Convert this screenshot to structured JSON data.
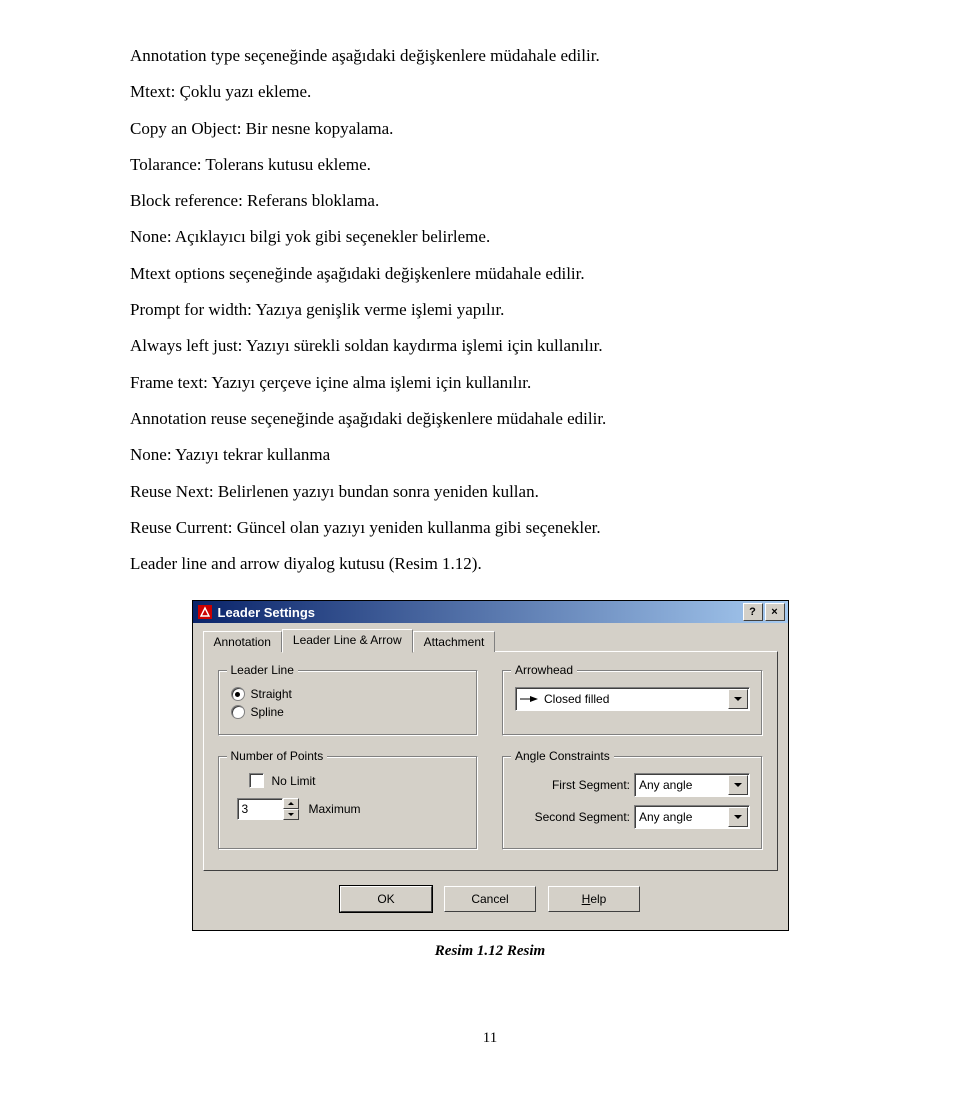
{
  "paragraphs": [
    "Annotation type seçeneğinde aşağıdaki değişkenlere müdahale edilir.",
    "Mtext: Çoklu yazı ekleme.",
    "Copy an Object: Bir nesne kopyalama.",
    "Tolarance: Tolerans kutusu ekleme.",
    "Block reference: Referans bloklama.",
    "None: Açıklayıcı bilgi yok gibi seçenekler belirleme.",
    "Mtext options seçeneğinde aşağıdaki değişkenlere müdahale edilir.",
    "Prompt for width: Yazıya genişlik verme işlemi yapılır.",
    "Always left just: Yazıyı sürekli soldan kaydırma işlemi için kullanılır.",
    "Frame text: Yazıyı çerçeve içine alma işlemi için kullanılır.",
    "Annotation reuse seçeneğinde aşağıdaki değişkenlere müdahale edilir.",
    "None: Yazıyı tekrar kullanma",
    "Reuse Next: Belirlenen yazıyı bundan sonra yeniden kullan.",
    "Reuse Current: Güncel olan yazıyı yeniden kullanma gibi seçenekler.",
    "Leader line and arrow diyalog kutusu (Resim 1.12)."
  ],
  "dialog": {
    "title": "Leader Settings",
    "help_btn": "?",
    "close_btn": "×",
    "tabs": [
      "Annotation",
      "Leader Line & Arrow",
      "Attachment"
    ],
    "active_tab": 1,
    "groups": {
      "leader_line": {
        "title": "Leader Line",
        "options": [
          "Straight",
          "Spline"
        ],
        "selected": "Straight"
      },
      "arrowhead": {
        "title": "Arrowhead",
        "value": "Closed filled"
      },
      "number_points": {
        "title": "Number of Points",
        "nolimit_label": "No Limit",
        "max_value": "3",
        "max_label": "Maximum"
      },
      "angle": {
        "title": "Angle Constraints",
        "first_label": "First Segment:",
        "first_value": "Any angle",
        "second_label": "Second Segment:",
        "second_value": "Any angle"
      }
    },
    "buttons": {
      "ok": "OK",
      "cancel": "Cancel",
      "help": "Help"
    }
  },
  "caption": "Resim 1.12 Resim",
  "page_number": "11"
}
